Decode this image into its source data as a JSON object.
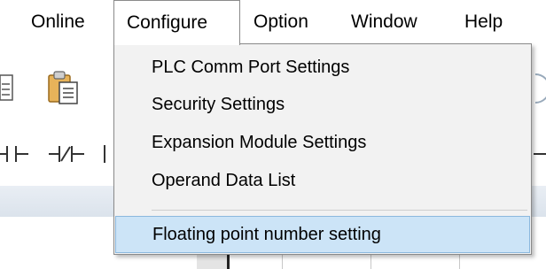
{
  "menubar": {
    "items": [
      {
        "label": "Online"
      },
      {
        "label": "Configure"
      },
      {
        "label": "Option"
      },
      {
        "label": "Window"
      },
      {
        "label": "Help"
      }
    ]
  },
  "configure_menu": {
    "items": [
      {
        "label": "PLC Comm Port Settings"
      },
      {
        "label": "Security Settings"
      },
      {
        "label": "Expansion Module Settings"
      },
      {
        "label": "Operand Data List"
      },
      {
        "label": "Floating point number setting"
      }
    ],
    "highlighted_index": 4
  },
  "toolbar": {
    "icons": [
      "paste-icon",
      "clipboard-icon",
      "contact-no-icon",
      "contact-nc-icon"
    ]
  },
  "colors": {
    "highlight_bg": "#cce4f7",
    "highlight_border": "#8bb8de",
    "menu_bg": "#f2f2f2"
  }
}
